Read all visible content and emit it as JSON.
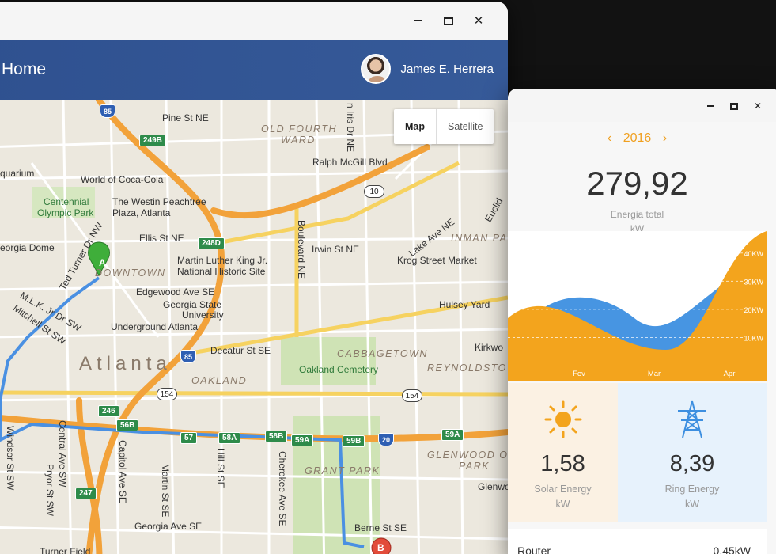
{
  "map_window": {
    "header_title": "Home",
    "user_name": "James E. Herrera",
    "map_toggle": {
      "map": "Map",
      "satellite": "Satellite"
    },
    "labels": {
      "pine_st": "Pine St NE",
      "old_fourth_ward_1": "OLD FOURTH",
      "old_fourth_ward_2": "WARD",
      "ralph_mcgill": "Ralph McGill Blvd",
      "aquarium": "quarium",
      "world_coca_cola": "World of Coca-Cola",
      "centennial_1": "Centennial",
      "centennial_2": "Olympic Park",
      "westin_1": "The Westin Peachtree",
      "westin_2": "Plaza, Atlanta",
      "ellis_st": "Ellis St NE",
      "georgia_dome": "eorgia Dome",
      "irwin_st": "Irwin St NE",
      "inman_park": "INMAN PA",
      "krog_street": "Krog Street Market",
      "mlk_1": "Martin Luther King Jr.",
      "mlk_2": "National Historic Site",
      "downtown": "DOWNTOWN",
      "edgewood": "Edgewood Ave SE",
      "gsu_1": "Georgia State",
      "gsu_2": "University",
      "underground": "Underground Atlanta",
      "hulsey_yard": "Hulsey Yard",
      "decatur_st": "Decatur St SE",
      "cabbagetown": "CABBAGETOWN",
      "kirkwood": "Kirkwo",
      "atlanta": "Atlanta",
      "oakland_cemetery": "Oakland Cemetery",
      "reynoldstown": "REYNOLDSTO",
      "oakland": "OAKLAND",
      "grant_park": "GRANT PARK",
      "glenwood_1": "GLENWOOD O",
      "glenwood_2": "PARK",
      "glenwo": "Glenwo",
      "georgia_ave": "Georgia Ave SE",
      "berne_st": "Berne St SE",
      "turner_field": "Turner Field",
      "boulevard": "Boulevard NE",
      "capitol_ave": "Capitol Ave SE",
      "central_ave": "Central Ave SW",
      "pryor_st": "Pryor St SW",
      "windsor_st": "Windsor St SW",
      "martin_st": "Martin St SE",
      "hill_st": "Hill St SE",
      "cherokee_ave": "Cherokee Ave SE",
      "ted_turner": "Ted Turner Dr NW",
      "mlk_dr": "M.L.K. Jr Dr SW",
      "mitchell_st": "Mitchell St SW",
      "lake_ave": "Lake Ave NE",
      "euclid": "Euclid",
      "john_st": "n Iris Dr NE",
      "marker_a": "A",
      "marker_b": "B"
    },
    "shields": {
      "i85_n": "85",
      "r249b": "249B",
      "r248d": "248D",
      "i85_s": "85",
      "r246": "246",
      "r56b": "56B",
      "r57": "57",
      "r58a": "58A",
      "r58b": "58B",
      "r59a": "59A",
      "r59b": "59B",
      "i20": "20",
      "r59a_e": "59A",
      "r247": "247",
      "us10": "10",
      "us154_w": "154",
      "us154_e": "154"
    }
  },
  "energy_window": {
    "year": "2016",
    "prev": "‹",
    "next": "›",
    "total_value": "279,92",
    "total_label": "Energia total",
    "total_unit": "kW",
    "solar": {
      "value": "1,58",
      "label": "Solar Energy",
      "unit": "kW"
    },
    "ring": {
      "value": "8,39",
      "label": "Ring Energy",
      "unit": "kW"
    },
    "router": {
      "name": "Router",
      "value": "0,45kW"
    },
    "colors": {
      "orange": "#f3a41d",
      "blue": "#3d8fe0",
      "accent": "#f0a020"
    }
  },
  "chart_data": {
    "type": "area",
    "categories": [
      "Fev",
      "Mar",
      "Apr"
    ],
    "y_ticks": [
      "10KW",
      "20KW",
      "30KW",
      "40KW"
    ],
    "ylim": [
      0,
      45
    ],
    "series": []
  }
}
